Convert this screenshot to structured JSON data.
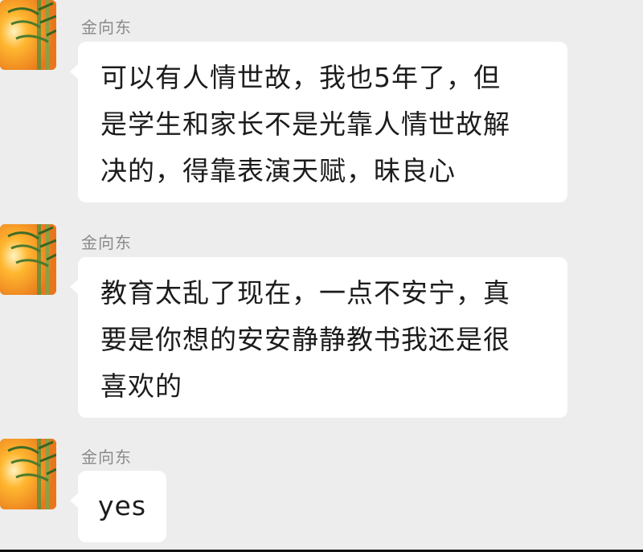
{
  "conversation": {
    "messages": [
      {
        "sender": "金向东",
        "lines": [
          "可以有人情世故，我也5年了，但",
          "是学生和家长不是光靠人情世故解",
          "决的，得靠表演天赋，昧良心"
        ]
      },
      {
        "sender": "金向东",
        "lines": [
          "教育太乱了现在，一点不安宁，真",
          "要是你想的安安静静教书我还是很",
          "喜欢的"
        ]
      },
      {
        "sender": "金向东",
        "lines": [
          "yes"
        ]
      }
    ]
  },
  "colors": {
    "background": "#ededed",
    "bubble": "#ffffff",
    "sender_text": "#8a8a8a",
    "message_text": "#1c1c1c"
  },
  "icons": {
    "avatar": "bamboo-sunset-avatar"
  }
}
